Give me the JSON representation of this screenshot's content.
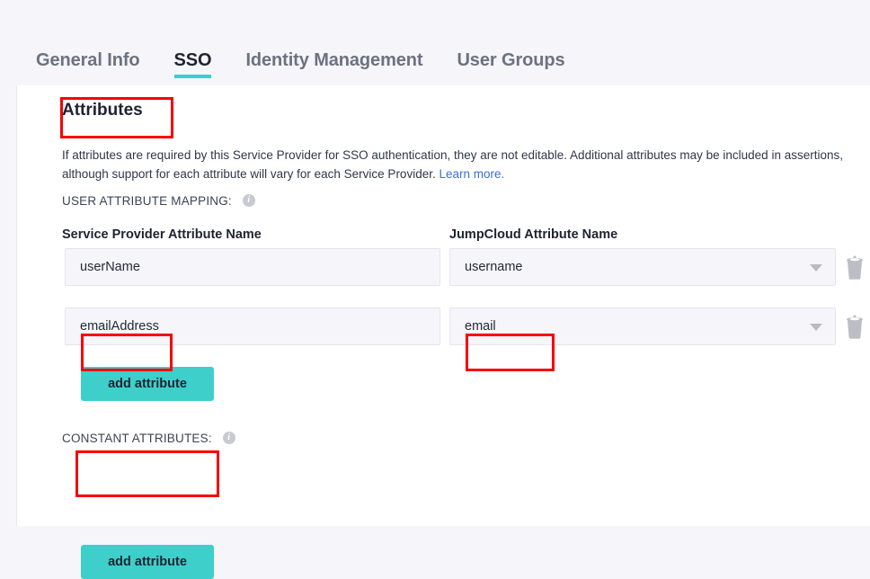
{
  "tabs": [
    {
      "label": "General Info",
      "active": false
    },
    {
      "label": "SSO",
      "active": true
    },
    {
      "label": "Identity Management",
      "active": false
    },
    {
      "label": "User Groups",
      "active": false
    }
  ],
  "panel": {
    "section_title": "Attributes",
    "description_text": "If attributes are required by this Service Provider for SSO authentication, they are not editable. Additional attributes may be included in assertions, although support for each attribute will vary for each Service Provider. ",
    "learn_more_label": "Learn more.",
    "user_attribute_mapping_label": "USER ATTRIBUTE MAPPING:",
    "constant_attributes_label": "CONSTANT ATTRIBUTES:",
    "info_icon_glyph": "i",
    "columns": {
      "service_provider": "Service Provider Attribute Name",
      "jumpcloud": "JumpCloud Attribute Name"
    },
    "rows": [
      {
        "sp_value": "userName",
        "sp_placeholder": "Service Provider Attribute Name",
        "jc_value": "username",
        "jc_placeholder": "JumpCloud Attribute Name",
        "delete_icon": "trash-icon",
        "caret_icon": "chevron-down-icon"
      },
      {
        "sp_value": "emailAddress",
        "sp_placeholder": "Service Provider Attribute Name",
        "jc_value": "email",
        "jc_placeholder": "JumpCloud Attribute Name",
        "delete_icon": "trash-icon",
        "caret_icon": "chevron-down-icon"
      }
    ],
    "add_attribute_user_label": "add attribute",
    "add_attribute_constant_label": "add attribute"
  },
  "colors": {
    "accent_teal": "#3ecfcb",
    "annotation_red": "#f70000",
    "link_blue": "#3d6fd1",
    "page_bg": "#f5f5fa",
    "field_bg": "#f5f5fa",
    "text_dark": "#1e2330"
  }
}
